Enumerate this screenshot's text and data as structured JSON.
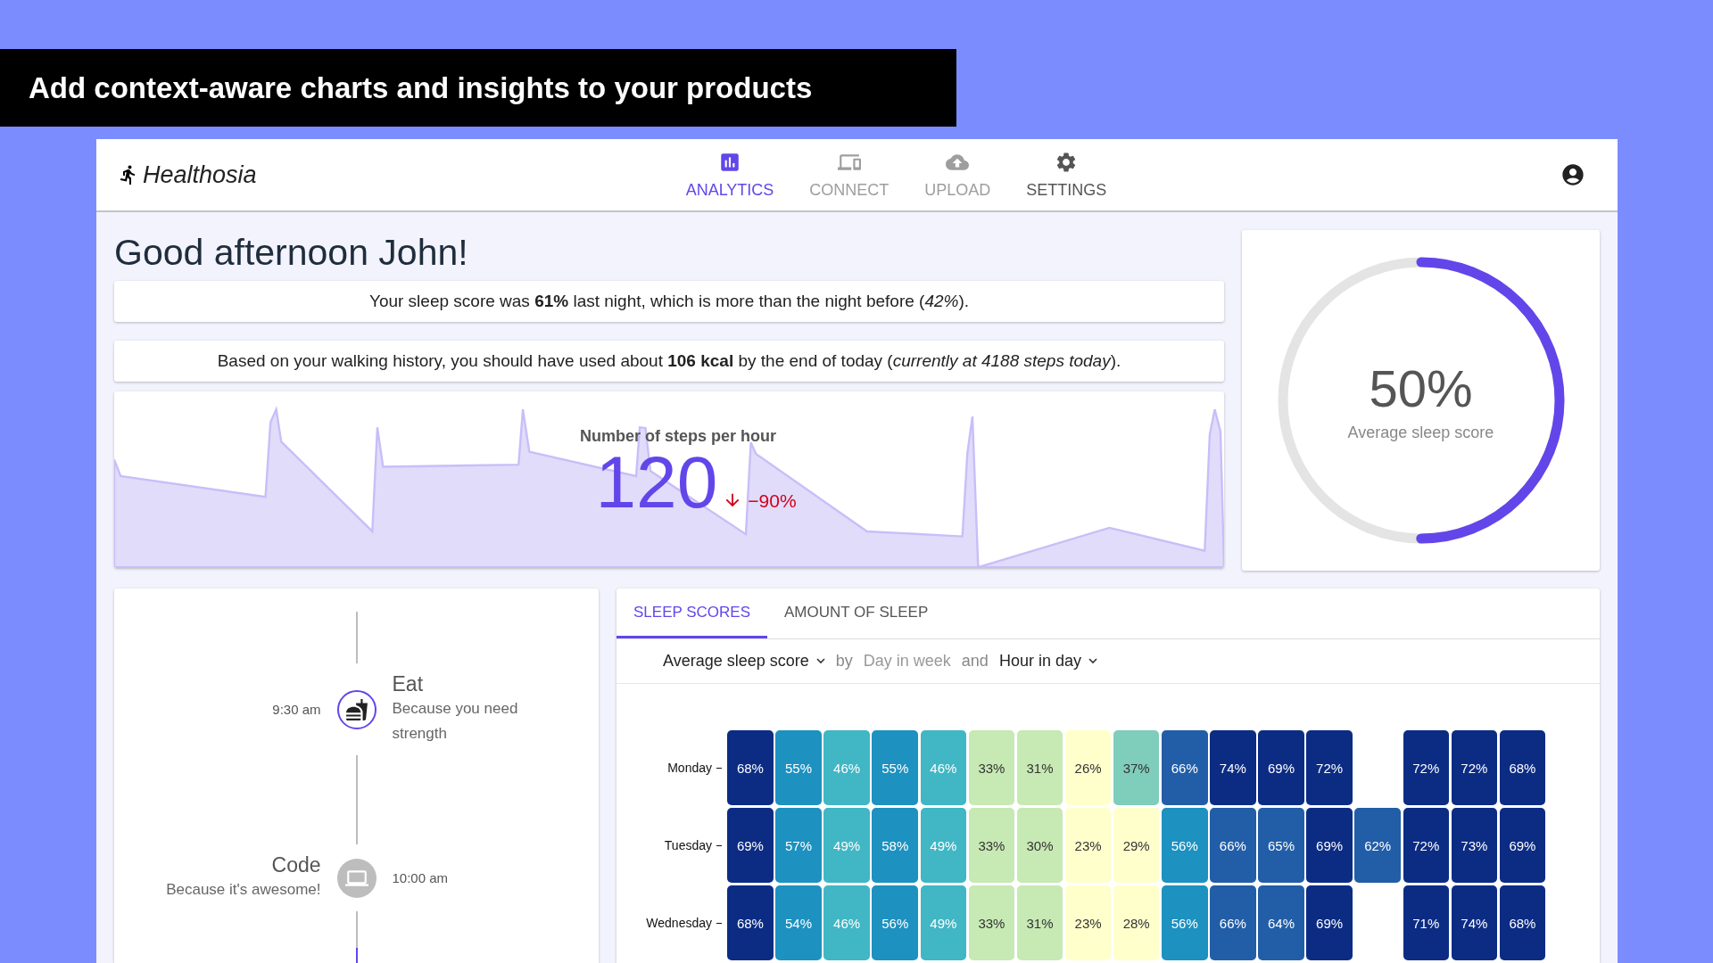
{
  "banner": {
    "text": "Add context-aware charts and insights to your products"
  },
  "app": {
    "name": "Healthosia"
  },
  "nav": [
    {
      "label": "ANALYTICS",
      "kind": "analytics",
      "selected": true,
      "disabled": false
    },
    {
      "label": "CONNECT",
      "kind": "connect",
      "selected": false,
      "disabled": true
    },
    {
      "label": "UPLOAD",
      "kind": "upload",
      "selected": false,
      "disabled": true
    },
    {
      "label": "SETTINGS",
      "kind": "settings",
      "selected": false,
      "disabled": false
    }
  ],
  "greeting": "Good afternoon John!",
  "insights": [
    "Your sleep score was **61%** last night, which is more than the night before (*42%*).",
    "Based on your walking history, you should have used about **106 kcal** by the end of today (*currently at 4188 steps today*)."
  ],
  "steps": {
    "title": "Number of steps per hour",
    "value": "120",
    "change": "−90%"
  },
  "gauge": {
    "value": "50%",
    "label": "Average sleep score",
    "level": 0.5
  },
  "timeline": [
    {
      "kind": "meal",
      "title": "Eat",
      "description": "Because you need strength",
      "time": "9:30 am",
      "active": true
    },
    {
      "kind": "work",
      "title": "Code",
      "description": "Because it's awesome!",
      "time": "10:00 am",
      "active": false
    }
  ],
  "heatmap": {
    "tabs": [
      {
        "label": "SLEEP SCORES",
        "selected": true
      },
      {
        "label": "AMOUNT OF SLEEP",
        "selected": false
      }
    ],
    "query": [
      {
        "kind": "dropdown",
        "label": "Average sleep score"
      },
      {
        "kind": "connector",
        "label": "by"
      },
      {
        "kind": "fixed",
        "label": "Day in week"
      },
      {
        "kind": "connector",
        "label": "and"
      },
      {
        "kind": "dropdown",
        "label": "Hour in day"
      }
    ],
    "rows": [
      {
        "label": "Monday",
        "cells": [
          {
            "value": "68%",
            "color": "#0c2c84"
          },
          {
            "value": "55%",
            "color": "#1d91c0"
          },
          {
            "value": "46%",
            "color": "#41b6c4"
          },
          {
            "value": "55%",
            "color": "#1d91c0"
          },
          {
            "value": "46%",
            "color": "#41b6c4"
          },
          {
            "value": "33%",
            "color": "#c7e9b4"
          },
          {
            "value": "31%",
            "color": "#c7e9b4"
          },
          {
            "value": "26%",
            "color": "#ffffcc"
          },
          {
            "value": "37%",
            "color": "#7fcdbb"
          },
          {
            "value": "66%",
            "color": "#225ea8"
          },
          {
            "value": "74%",
            "color": "#0c2c84"
          },
          {
            "value": "69%",
            "color": "#0c2c84"
          },
          {
            "value": "72%",
            "color": "#0c2c84"
          },
          null,
          {
            "value": "72%",
            "color": "#0c2c84"
          },
          {
            "value": "72%",
            "color": "#0c2c84"
          },
          {
            "value": "68%",
            "color": "#0c2c84"
          }
        ]
      },
      {
        "label": "Tuesday",
        "cells": [
          {
            "value": "69%",
            "color": "#0c2c84"
          },
          {
            "value": "57%",
            "color": "#1d91c0"
          },
          {
            "value": "49%",
            "color": "#41b6c4"
          },
          {
            "value": "58%",
            "color": "#1d91c0"
          },
          {
            "value": "49%",
            "color": "#41b6c4"
          },
          {
            "value": "33%",
            "color": "#c7e9b4"
          },
          {
            "value": "30%",
            "color": "#c7e9b4"
          },
          {
            "value": "23%",
            "color": "#ffffcc"
          },
          {
            "value": "29%",
            "color": "#ffffcc"
          },
          {
            "value": "56%",
            "color": "#1d91c0"
          },
          {
            "value": "66%",
            "color": "#225ea8"
          },
          {
            "value": "65%",
            "color": "#225ea8"
          },
          {
            "value": "69%",
            "color": "#0c2c84"
          },
          {
            "value": "62%",
            "color": "#225ea8"
          },
          {
            "value": "72%",
            "color": "#0c2c84"
          },
          {
            "value": "73%",
            "color": "#0c2c84"
          },
          {
            "value": "69%",
            "color": "#0c2c84"
          }
        ]
      },
      {
        "label": "Wednesday",
        "cells": [
          {
            "value": "68%",
            "color": "#0c2c84"
          },
          {
            "value": "54%",
            "color": "#1d91c0"
          },
          {
            "value": "46%",
            "color": "#41b6c4"
          },
          {
            "value": "56%",
            "color": "#1d91c0"
          },
          {
            "value": "49%",
            "color": "#41b6c4"
          },
          {
            "value": "33%",
            "color": "#c7e9b4"
          },
          {
            "value": "31%",
            "color": "#c7e9b4"
          },
          {
            "value": "23%",
            "color": "#ffffcc"
          },
          {
            "value": "28%",
            "color": "#ffffcc"
          },
          {
            "value": "56%",
            "color": "#1d91c0"
          },
          {
            "value": "66%",
            "color": "#225ea8"
          },
          {
            "value": "64%",
            "color": "#225ea8"
          },
          {
            "value": "69%",
            "color": "#0c2c84"
          },
          null,
          {
            "value": "71%",
            "color": "#0c2c84"
          },
          {
            "value": "74%",
            "color": "#0c2c84"
          },
          {
            "value": "68%",
            "color": "#0c2c84"
          }
        ]
      }
    ]
  }
}
